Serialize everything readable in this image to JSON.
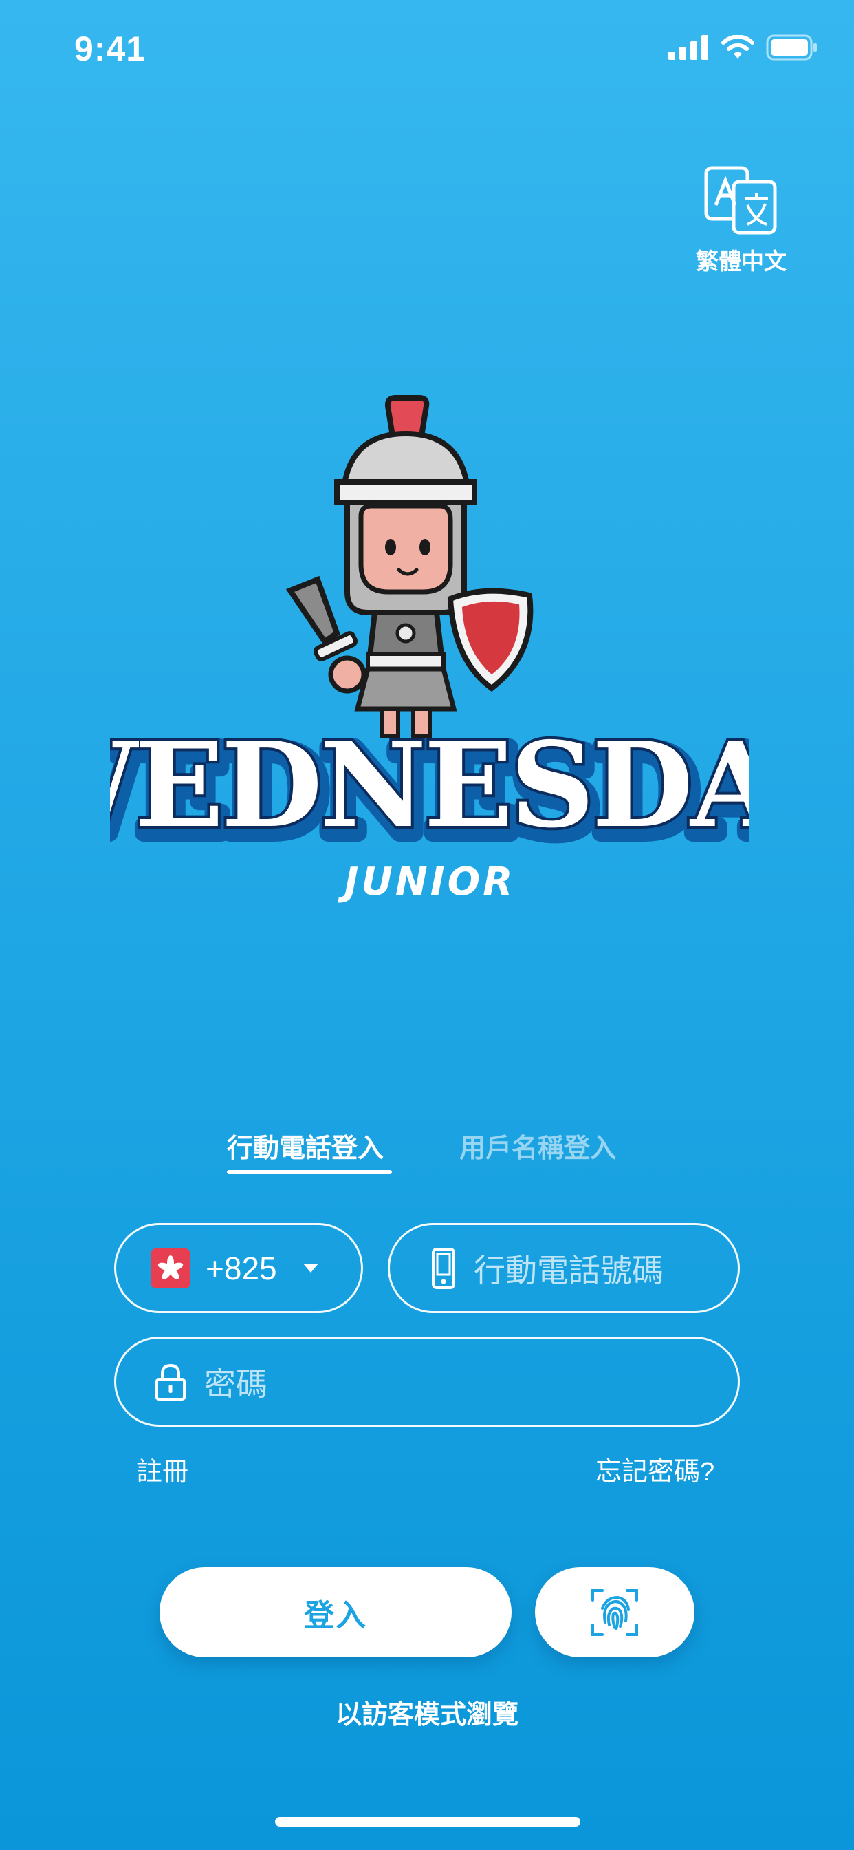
{
  "status_bar": {
    "time": "9:41",
    "icons": [
      "signal-icon",
      "wifi-icon",
      "battery-icon"
    ]
  },
  "language": {
    "label": "繁體中文",
    "icon": "translate-icon"
  },
  "logo": {
    "title": "WEDNESDAY",
    "subtitle": "JUNIOR",
    "mascot": "roman-soldier-mascot"
  },
  "tabs": [
    {
      "label": "行動電話登入",
      "active": true
    },
    {
      "label": "用戶名稱登入",
      "active": false
    }
  ],
  "form": {
    "country_code": "+825",
    "country_flag": "hong-kong-flag-icon",
    "phone_placeholder": "行動電話號碼",
    "password_placeholder": "密碼"
  },
  "links": {
    "register": "註冊",
    "forgot_password": "忘記密碼?"
  },
  "buttons": {
    "login": "登入",
    "biometric_icon": "fingerprint-icon"
  },
  "guest_browse": "以訪客模式瀏覽",
  "colors": {
    "background_top": "#36b7ef",
    "background_bottom": "#0a96d9",
    "accent": "#1ba3e2",
    "flag_red": "#e83e52"
  }
}
